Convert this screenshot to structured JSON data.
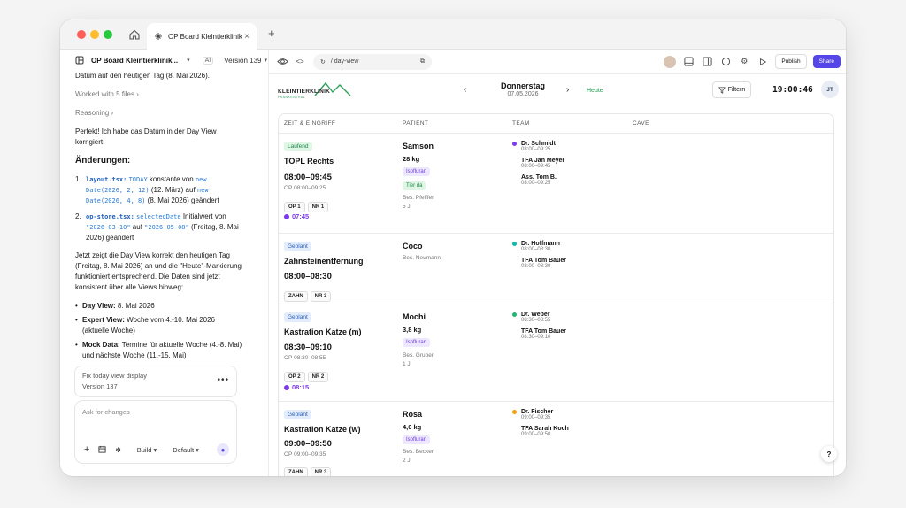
{
  "browser": {
    "tab_title": "OP Board Kleintierklinik",
    "url": "/ day-view"
  },
  "sidebar": {
    "project_name": "OP Board Kleintierklinik...",
    "ai_badge": "AI",
    "version": "Version 139",
    "chat": {
      "intro_line": "Datum auf den heutigen Tag (8. Mai 2026).",
      "worked_with": "Worked with 5 files",
      "reasoning": "Reasoning",
      "para1": "Perfekt! Ich habe das Datum in der Day View korrigiert:",
      "changes_heading": "Änderungen:",
      "change1_file": "layout.tsx:",
      "change1_code1": "TODAY",
      "change1_text1": " konstante von ",
      "change1_code2": "new Date(2026, 2, 12)",
      "change1_text2": " (12. März) auf ",
      "change1_code3": "new Date(2026, 4, 8)",
      "change1_text3": " (8. Mai 2026) geändert",
      "change2_file": "op-store.tsx:",
      "change2_code1": "selectedDate",
      "change2_text1": " Initialwert von ",
      "change2_code2": "\"2026-03-10\"",
      "change2_text2": " auf ",
      "change2_code3": "\"2026-05-08\"",
      "change2_text3": " (Freitag, 8. Mai 2026) geändert",
      "para2": "Jetzt zeigt die Day View korrekt den heutigen Tag (Freitag, 8. Mai 2026) an und die \"Heute\"-Markierung funktioniert entsprechend. Die Daten sind jetzt konsistent über alle Views hinweg:",
      "bullet1_label": "Day View:",
      "bullet1_text": " 8. Mai 2026",
      "bullet2_label": "Expert View:",
      "bullet2_text": " Woche vom 4.-10. Mai 2026 (aktuelle Woche)",
      "bullet3_label": "Mock Data:",
      "bullet3_text": " Termine für aktuelle Woche (4.-8. Mai) und nächste Woche (11.-15. Mai)"
    },
    "version_card": {
      "title": "Fix today view display",
      "version": "Version 137",
      "menu": "•••"
    },
    "composer": {
      "placeholder": "Ask for changes",
      "build": "Build",
      "mode": "Default"
    }
  },
  "toolbar": {
    "publish": "Publish",
    "share": "Share"
  },
  "header": {
    "logo_text": "KLEINTIERKLINIK",
    "logo_sub": "FRANKENTHAL",
    "day": "Donnerstag",
    "date": "07.05.2026",
    "today": "Heute",
    "filter": "Filtern",
    "clock": "19:00:46",
    "user_initials": "JT"
  },
  "board": {
    "columns": [
      "ZEIT & EINGRIFF",
      "PATIENT",
      "TEAM",
      "CAVE"
    ],
    "ops": [
      {
        "status": "Laufend",
        "procedure": "TOPL Rechts",
        "time": "08:00–09:45",
        "op_time": "OP 08:00–09:25",
        "tags": [
          "OP 1",
          "NR 1"
        ],
        "live": "07:45",
        "patient": "Samson",
        "weight": "28 kg",
        "pills": [
          "Isofluran",
          "Tier da"
        ],
        "owner": "Bes. Pfeiffer",
        "age": "5 J",
        "team": [
          {
            "name": "Dr. Schmidt",
            "time": "08:00–09:25",
            "color": "#7c3aed"
          },
          {
            "name": "TFA Jan Meyer",
            "time": "08:00–09:45",
            "color": ""
          },
          {
            "name": "Ass. Tom B.",
            "time": "08:00–09:25",
            "color": ""
          }
        ]
      },
      {
        "status": "Geplant",
        "procedure": "Zahnsteinentfernung",
        "time": "08:00–08:30",
        "tags": [
          "ZAHN",
          "NR 3"
        ],
        "patient": "Coco",
        "owner": "Bes. Neumann",
        "team": [
          {
            "name": "Dr. Hoffmann",
            "time": "08:00–08:30",
            "color": "#14b8a6"
          },
          {
            "name": "TFA Tom Bauer",
            "time": "08:00–08:30",
            "color": ""
          }
        ]
      },
      {
        "status": "Geplant",
        "procedure": "Kastration Katze (m)",
        "time": "08:30–09:10",
        "op_time": "OP 08:30–08:55",
        "tags": [
          "OP 2",
          "NR 2"
        ],
        "live": "08:15",
        "patient": "Mochi",
        "weight": "3,8 kg",
        "pills": [
          "Isofluran"
        ],
        "owner": "Bes. Gruber",
        "age": "1 J",
        "team": [
          {
            "name": "Dr. Weber",
            "time": "08:30–08:55",
            "color": "#22b573"
          },
          {
            "name": "TFA Tom Bauer",
            "time": "08:30–09:10",
            "color": ""
          }
        ]
      },
      {
        "status": "Geplant",
        "procedure": "Kastration Katze (w)",
        "time": "09:00–09:50",
        "op_time": "OP 09:00–09:35",
        "tags": [
          "ZAHN",
          "NR 3"
        ],
        "patient": "Rosa",
        "weight": "4,0 kg",
        "pills": [
          "Isofluran"
        ],
        "owner": "Bes. Becker",
        "age": "2 J",
        "team": [
          {
            "name": "Dr. Fischer",
            "time": "09:00–09:35",
            "color": "#f59e0b"
          },
          {
            "name": "TFA Sarah Koch",
            "time": "09:00–09:50",
            "color": ""
          }
        ]
      }
    ]
  },
  "help": "?"
}
